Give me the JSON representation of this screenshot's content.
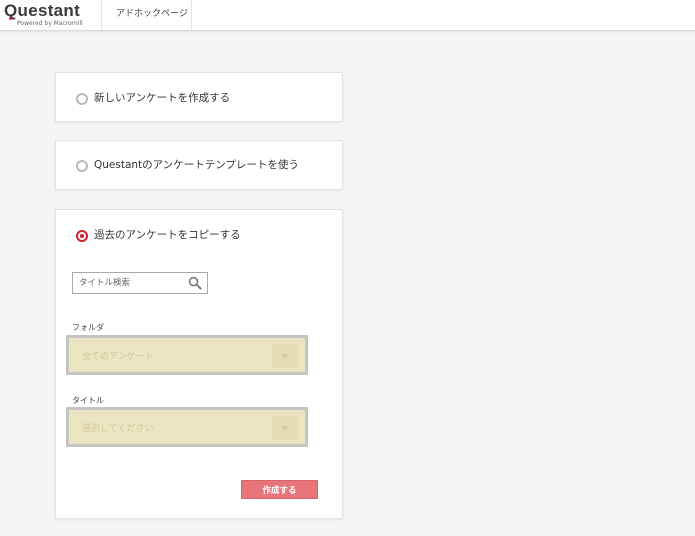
{
  "header": {
    "logo_text": "Questant",
    "logo_subtitle": "Powered by Macromill",
    "nav_adhoc_label": "アドホックページ"
  },
  "options": {
    "new_survey_label": "新しいアンケートを作成する",
    "template_label": "Questantのアンケートテンプレートを使う",
    "copy_past_label": "過去のアンケートをコピーする"
  },
  "selected_option": "copy_past",
  "copy_panel": {
    "search_placeholder": "タイトル検索",
    "folder_label": "フォルダ",
    "folder_value": "全てのアンケート",
    "title_label": "タイトル",
    "title_value": "選択してください",
    "create_button_label": "作成する"
  },
  "colors": {
    "accent": "#cc1f2d",
    "create_button": "#e7757a",
    "select_disabled_bg": "#ece5c2",
    "page_bg": "#f5f5f5"
  }
}
